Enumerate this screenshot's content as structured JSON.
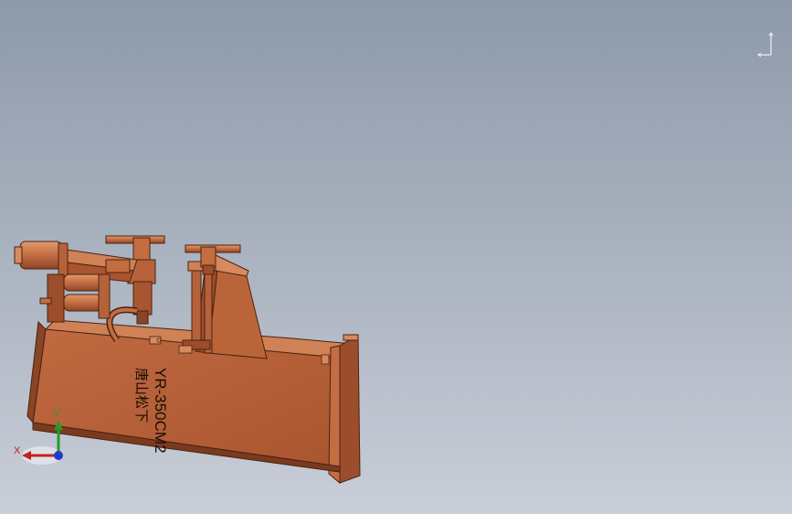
{
  "model": {
    "label_line1": "唐山松下",
    "label_line2": "YR-350CM2"
  },
  "triad": {
    "x_label": "X",
    "y_label": "Y"
  },
  "colors": {
    "background_top": "#8e9aaa",
    "background_bottom": "#c9ced8",
    "body_main": "#b5623b",
    "body_dark": "#8a4426",
    "body_light": "#d78a5f",
    "axis_x": "#c81e1e",
    "axis_y": "#1e9e28",
    "axis_z": "#1e3ccc"
  },
  "icons": {
    "view_orientation": "view-orientation-icon",
    "reference_triad": "reference-triad-icon"
  }
}
